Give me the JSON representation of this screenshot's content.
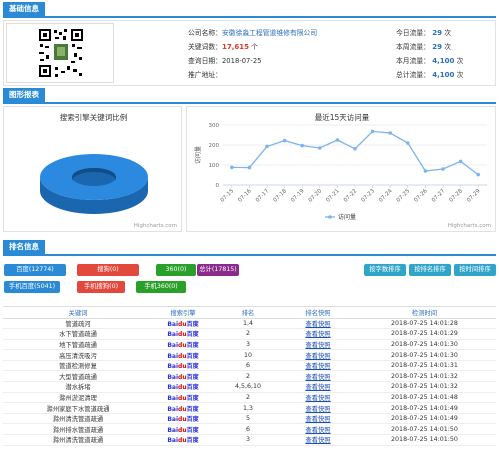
{
  "sections": {
    "basic": "基础信息",
    "charts": "图形报表",
    "ranking": "排名信息"
  },
  "basic": {
    "company_label": "公司名称：",
    "company_value": "安徽徐淼工程管道维修有限公司",
    "keywords_label": "关键词数：",
    "keywords_value": "17,615",
    "keywords_unit": "个",
    "date_label": "查询日期：",
    "date_value": "2018-07-25",
    "site_label": "推广地址：",
    "today_label": "今日流量：",
    "today_value": "29",
    "week_label": "本周流量：",
    "week_value": "29",
    "month_label": "本月流量：",
    "month_value": "4,100",
    "total_label": "总计流量：",
    "total_value": "4,100",
    "unit_times": "次"
  },
  "pie_chart": {
    "title": "搜索引擎关键词比例",
    "credits": "Highcharts.com"
  },
  "chart_data": {
    "type": "line",
    "title": "最近15天访问量",
    "ylabel": "访问量",
    "xlabel": "",
    "categories": [
      "07-15",
      "07-16",
      "07-17",
      "07-18",
      "07-19",
      "07-20",
      "07-21",
      "07-22",
      "07-23",
      "07-24",
      "07-25",
      "07-26",
      "07-27",
      "07-28",
      "07-29"
    ],
    "series": [
      {
        "name": "访问量",
        "values": [
          88,
          87,
          193,
          222,
          197,
          185,
          225,
          181,
          268,
          260,
          210,
          70,
          80,
          118,
          52
        ]
      }
    ],
    "ylim": [
      0,
      300
    ],
    "yticks": [
      "0",
      "100",
      "200",
      "300"
    ],
    "grid": true,
    "legend": "bottom-center",
    "color": "#7cb5ec",
    "credits": "Highcharts.com"
  },
  "filters": {
    "baidu": "百度(12774)",
    "sogou": "搜狗(0)",
    "s360": "360(0)",
    "total": "总计(17815)",
    "mobile_baidu": "手机百度(5041)",
    "mobile_sogou": "手机搜狗(0)",
    "mobile_360": "手机360(0)",
    "sort_keyword": "按字数排序",
    "sort_rank": "按排名排序",
    "sort_time": "按时间排序"
  },
  "table": {
    "headers": [
      "关键词",
      "搜索引擎",
      "排名",
      "排名快照",
      "检测时间"
    ],
    "engine_logo": "Bai du 百度",
    "rows": [
      {
        "kw": "管道疏河",
        "rank": "1,4",
        "snap": "查看快照",
        "time": "2018-07-25 14:01:28"
      },
      {
        "kw": "水下管道疏通",
        "rank": "2",
        "snap": "查看快照",
        "time": "2018-07-25 14:01:29"
      },
      {
        "kw": "地下管道疏通",
        "rank": "3",
        "snap": "查看快照",
        "time": "2018-07-25 14:01:30"
      },
      {
        "kw": "高压清洗吸污",
        "rank": "10",
        "snap": "查看快照",
        "time": "2018-07-25 14:01:30"
      },
      {
        "kw": "管道检测修复",
        "rank": "6",
        "snap": "查看快照",
        "time": "2018-07-25 14:01:31"
      },
      {
        "kw": "大型管道疏通",
        "rank": "2",
        "snap": "查看快照",
        "time": "2018-07-25 14:01:32"
      },
      {
        "kw": "潜水拆堵",
        "rank": "4,5,6,10",
        "snap": "查看快照",
        "time": "2018-07-25 14:01:32"
      },
      {
        "kw": "滁州淤泥清理",
        "rank": "2",
        "snap": "查看快照",
        "time": "2018-07-25 14:01:48"
      },
      {
        "kw": "滁州家庭下水管道疏通",
        "rank": "1,3",
        "snap": "查看快照",
        "time": "2018-07-25 14:01:49"
      },
      {
        "kw": "滁州清洗管道疏通",
        "rank": "5",
        "snap": "查看快照",
        "time": "2018-07-25 14:01:49"
      },
      {
        "kw": "滁州排水管道疏通",
        "rank": "6",
        "snap": "查看快照",
        "time": "2018-07-25 14:01:50"
      },
      {
        "kw": "滁州清洗管道疏通",
        "rank": "3",
        "snap": "查看快照",
        "time": "2018-07-25 14:01:50"
      }
    ]
  }
}
